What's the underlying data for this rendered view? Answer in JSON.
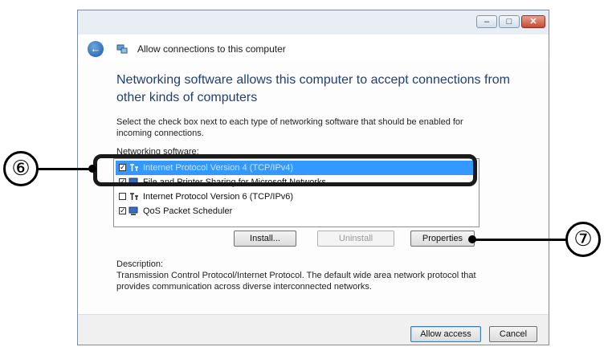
{
  "window": {
    "nav_title": "Allow connections to this computer",
    "controls": {
      "minimize": "–",
      "maximize": "□",
      "close": "✕"
    }
  },
  "heading": "Networking software allows this computer to accept connections from other kinds of computers",
  "instruction": "Select the check box next to each type of networking software that should be enabled for incoming connections.",
  "networking_label": "Networking software:",
  "software": [
    {
      "label": "Internet Protocol Version 4 (TCP/IPv4)",
      "checked": true,
      "selected": true,
      "icon": "protocol-icon"
    },
    {
      "label": "File and Printer Sharing for Microsoft Networks",
      "checked": true,
      "selected": false,
      "icon": "network-service-icon"
    },
    {
      "label": "Internet Protocol Version 6 (TCP/IPv6)",
      "checked": false,
      "selected": false,
      "icon": "protocol-icon"
    },
    {
      "label": "QoS Packet Scheduler",
      "checked": true,
      "selected": false,
      "icon": "network-service-icon"
    }
  ],
  "buttons": {
    "install": "Install...",
    "uninstall": "Uninstall",
    "properties": "Properties",
    "allow": "Allow access",
    "cancel": "Cancel"
  },
  "description_label": "Description:",
  "description": "Transmission Control Protocol/Internet Protocol. The default wide area network protocol that provides communication across diverse interconnected networks.",
  "callouts": {
    "six": "⑥",
    "seven": "⑦"
  },
  "colors": {
    "selection": "#3399ff",
    "heading": "#1f3f74"
  }
}
